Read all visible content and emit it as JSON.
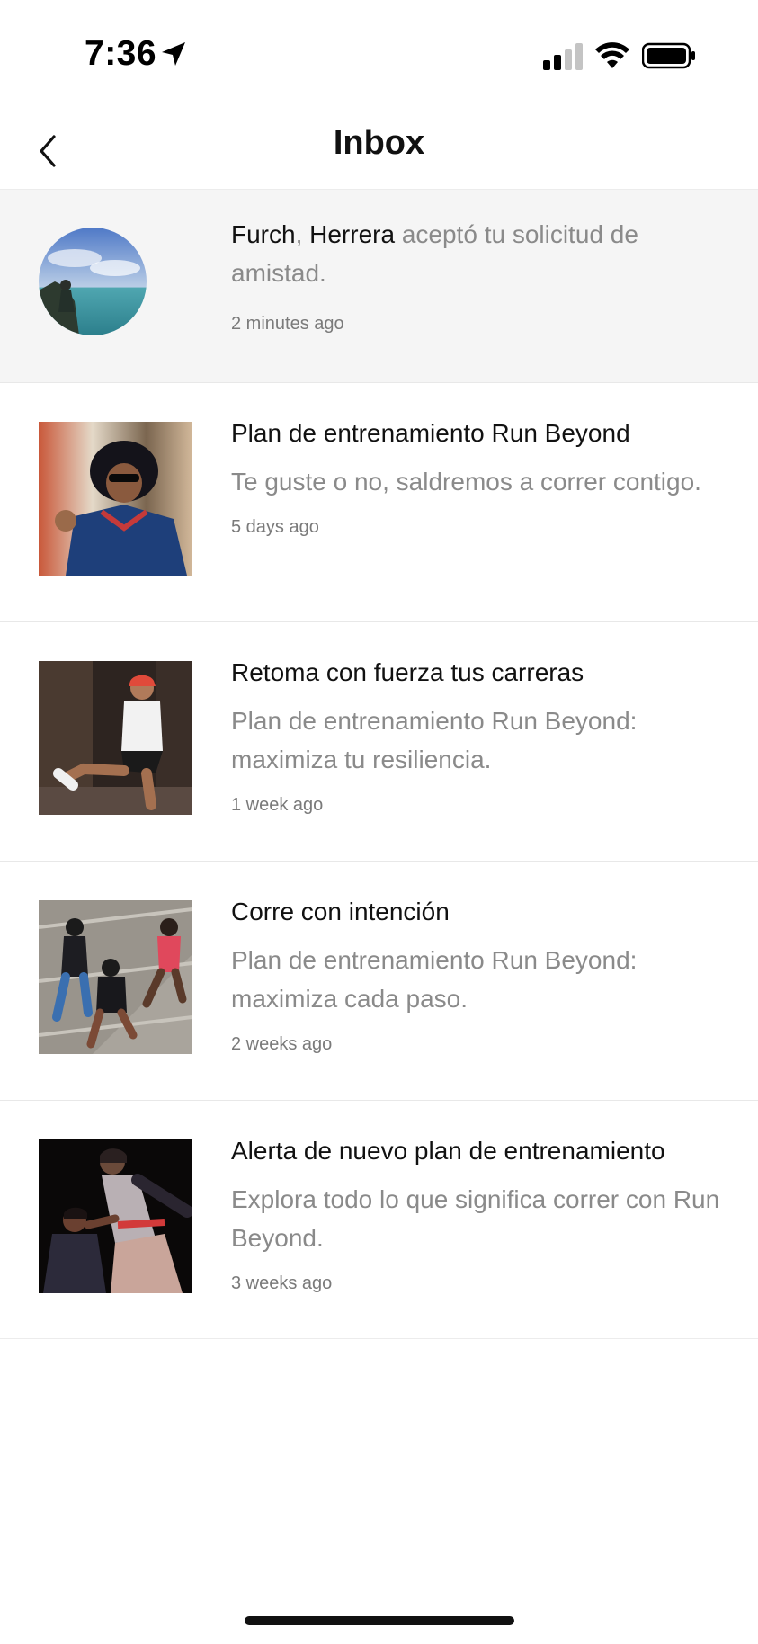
{
  "status_bar": {
    "time": "7:36",
    "icons": [
      "location-arrow-icon",
      "cellular-signal-icon",
      "wifi-icon",
      "battery-icon"
    ]
  },
  "header": {
    "title": "Inbox",
    "back_icon": "chevron-left-icon"
  },
  "friend_notification": {
    "name_1": "Furch",
    "separator": ",",
    "name_2": "Herrera",
    "message": "aceptó tu solicitud de amistad.",
    "time_ago": "2 minutes ago"
  },
  "messages": [
    {
      "title": "Plan de entrenamiento Run Beyond",
      "body": "Te guste o no, saldremos a correr contigo.",
      "time_ago": "5 days ago"
    },
    {
      "title": "Retoma con fuerza tus carreras",
      "body": "Plan de entrenamiento Run Beyond: maximiza tu resiliencia.",
      "time_ago": "1 week ago"
    },
    {
      "title": "Corre con intención",
      "body": "Plan de entrenamiento Run Beyond: maximiza cada paso.",
      "time_ago": "2 weeks ago"
    },
    {
      "title": "Alerta de nuevo plan de entrenamiento",
      "body": "Explora todo lo que significa correr con Run Beyond.",
      "time_ago": "3 weeks ago"
    }
  ],
  "colors": {
    "text_primary": "#111111",
    "text_muted": "#8a8a8a",
    "highlight_row": "#f5f5f5",
    "divider": "#e8e8e8"
  }
}
